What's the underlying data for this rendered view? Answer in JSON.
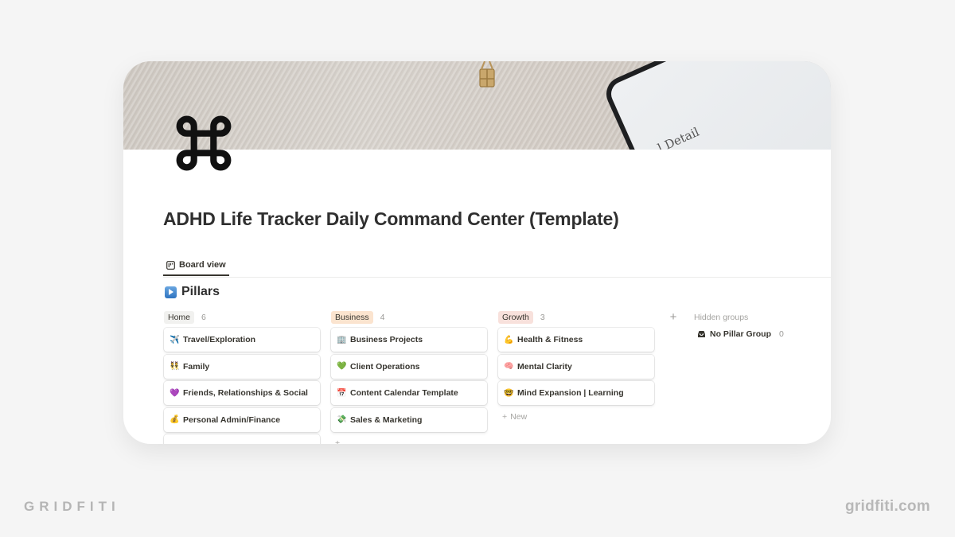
{
  "page": {
    "title": "ADHD Life Tracker Daily Command Center (Template)",
    "icon": "command-key-icon",
    "cover_text": "l Detail"
  },
  "views": {
    "tabs": [
      {
        "label": "Board view",
        "icon": "board-view-icon",
        "active": true
      }
    ]
  },
  "database": {
    "title": "Pillars",
    "icon": "play-button-icon",
    "groups": [
      {
        "name": "Home",
        "count": "6",
        "color": "#f1f1ef",
        "items": [
          {
            "emoji": "✈️",
            "label": "Travel/Exploration"
          },
          {
            "emoji": "👯",
            "label": "Family"
          },
          {
            "emoji": "💜",
            "label": "Friends, Relationships & Social"
          },
          {
            "emoji": "💰",
            "label": "Personal Admin/Finance"
          }
        ]
      },
      {
        "name": "Business",
        "count": "4",
        "color": "#fbe4cf",
        "items": [
          {
            "emoji": "🏢",
            "label": "Business Projects"
          },
          {
            "emoji": "💚",
            "label": "Client Operations"
          },
          {
            "emoji": "📅",
            "label": "Content Calendar Template"
          },
          {
            "emoji": "💸",
            "label": "Sales & Marketing"
          }
        ]
      },
      {
        "name": "Growth",
        "count": "3",
        "color": "#f8e1dc",
        "items": [
          {
            "emoji": "💪",
            "label": "Health & Fitness"
          },
          {
            "emoji": "🧠",
            "label": "Mental Clarity"
          },
          {
            "emoji": "🤓",
            "label": "Mind Expansion | Learning"
          }
        ],
        "new_label": "New"
      }
    ],
    "add_group_label": "+",
    "hidden_groups": {
      "title": "Hidden groups",
      "items": [
        {
          "label": "No Pillar Group",
          "count": "0",
          "icon": "inbox-icon"
        }
      ]
    }
  },
  "branding": {
    "left": "GRIDFITI",
    "right": "gridfiti.com"
  }
}
